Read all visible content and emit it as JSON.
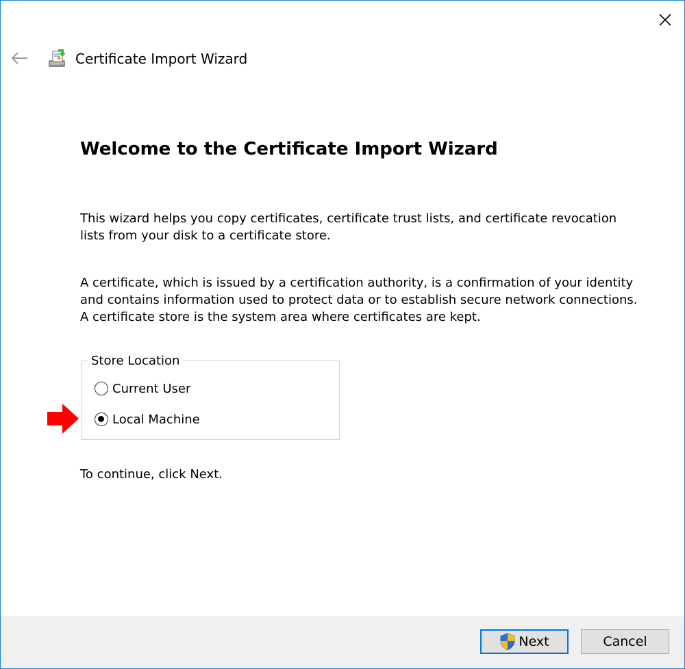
{
  "window": {
    "title": "Certificate Import Wizard"
  },
  "content": {
    "heading": "Welcome to the Certificate Import Wizard",
    "paragraph1": "This wizard helps you copy certificates, certificate trust lists, and certificate revocation lists from your disk to a certificate store.",
    "paragraph2": "A certificate, which is issued by a certification authority, is a confirmation of your identity and contains information used to protect data or to establish secure network connections. A certificate store is the system area where certificates are kept.",
    "store_location": {
      "legend": "Store Location",
      "options": [
        {
          "label": "Current User",
          "selected": false
        },
        {
          "label": "Local Machine",
          "selected": true
        }
      ]
    },
    "continue_text": "To continue, click Next."
  },
  "footer": {
    "next_label": "Next",
    "cancel_label": "Cancel"
  },
  "icons": {
    "close": "close-icon",
    "back": "back-arrow-icon",
    "wizard": "certificate-wizard-icon",
    "shield": "uac-shield-icon",
    "annotation": "red-arrow-icon"
  },
  "colors": {
    "accent": "#0078d7",
    "window_border": "#1883d7",
    "annotation_arrow": "#ff0000",
    "footer_bg": "#f0f0f0"
  }
}
